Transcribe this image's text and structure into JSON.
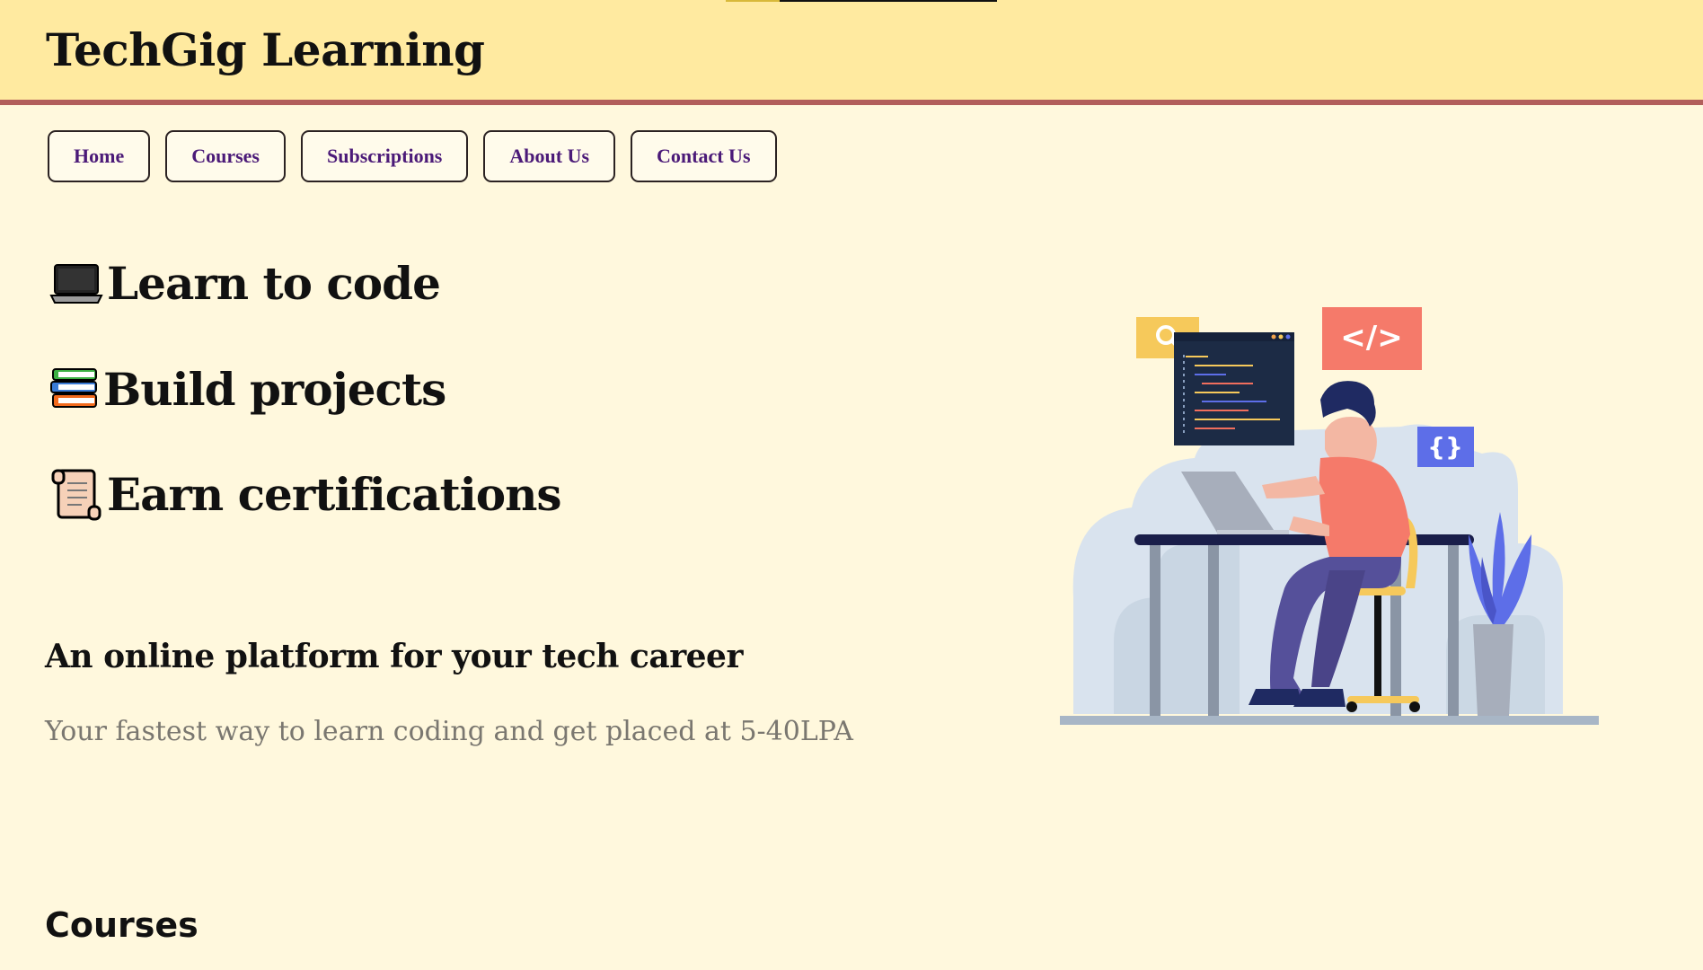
{
  "header": {
    "brand": "TechGig Learning"
  },
  "nav": {
    "items": [
      {
        "label": "Home"
      },
      {
        "label": "Courses"
      },
      {
        "label": "Subscriptions"
      },
      {
        "label": "About Us"
      },
      {
        "label": "Contact Us"
      }
    ]
  },
  "features": [
    {
      "icon": "laptop-icon",
      "label": "Learn to code"
    },
    {
      "icon": "books-icon",
      "label": "Build projects"
    },
    {
      "icon": "scroll-icon",
      "label": "Earn certifications"
    }
  ],
  "hero": {
    "tagline": "An online platform for your tech career",
    "subtext": "Your fastest way to learn coding and get placed at 5-40LPA",
    "illustration": {
      "code_badge": "</>",
      "braces_badge": "{}"
    }
  },
  "sections": {
    "courses_title": "Courses"
  },
  "colors": {
    "header_bg": "#ffeaa0",
    "header_border": "#b25e5a",
    "page_bg": "#fff8dd",
    "nav_text": "#4b1a78",
    "subtext": "#7a7770"
  }
}
